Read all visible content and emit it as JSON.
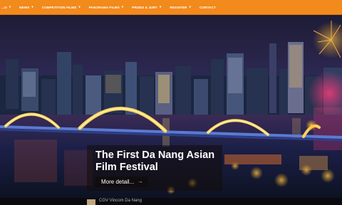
{
  "nav": {
    "items": [
      {
        "label": "...O",
        "dropdown": true
      },
      {
        "label": "NEWS",
        "dropdown": true
      },
      {
        "label": "COMPETITION FILMS",
        "dropdown": true
      },
      {
        "label": "PANORAMA FILMS",
        "dropdown": true
      },
      {
        "label": "PRIZES & JURY",
        "dropdown": true
      },
      {
        "label": "REGISTER",
        "dropdown": true
      },
      {
        "label": "CONTACT",
        "dropdown": false
      }
    ],
    "color": "#f28a1c"
  },
  "hero": {
    "title": "The First Da Nang Asian Film Festival",
    "cta_label": "More detail...",
    "cta_icon": "arrow-right-icon"
  },
  "footer": {
    "venue_text": "CGV Vincom Da Nang"
  }
}
